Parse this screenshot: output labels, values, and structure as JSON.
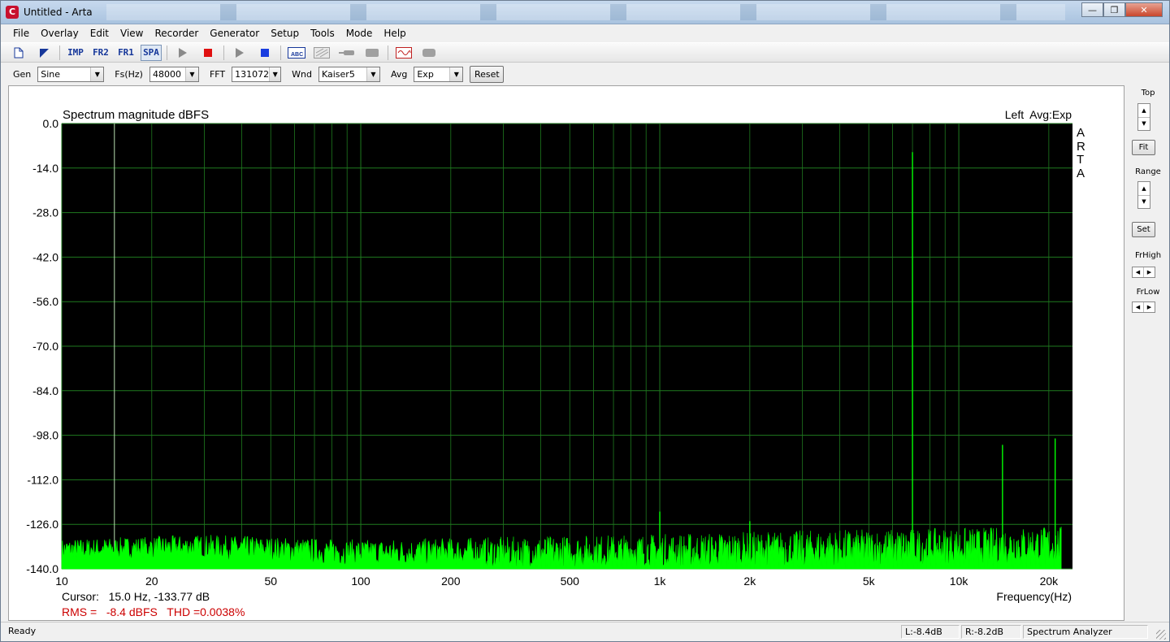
{
  "window": {
    "title": "Untitled - Arta",
    "app_icon_letter": "C"
  },
  "menu": [
    "File",
    "Overlay",
    "Edit",
    "View",
    "Recorder",
    "Generator",
    "Setup",
    "Tools",
    "Mode",
    "Help"
  ],
  "toolbar": {
    "buttons": [
      {
        "name": "new-document",
        "icon": "doc-icon",
        "text": ""
      },
      {
        "name": "open-file",
        "icon": "open-arrow-icon",
        "text": ""
      },
      {
        "name": "impulse-mode",
        "icon": "",
        "text": "IMP"
      },
      {
        "name": "fr2-mode",
        "icon": "",
        "text": "FR2"
      },
      {
        "name": "fr1-mode",
        "icon": "",
        "text": "FR1"
      },
      {
        "name": "spa-mode",
        "icon": "",
        "text": "SPA"
      },
      {
        "name": "play-record",
        "icon": "play-icon",
        "text": ""
      },
      {
        "name": "stop-record",
        "icon": "stop-icon",
        "text": ""
      },
      {
        "name": "play-generator",
        "icon": "play-icon",
        "text": ""
      },
      {
        "name": "stop-generator",
        "icon": "stop-icon",
        "text": ""
      },
      {
        "name": "overlay-set",
        "icon": "overlay-icon",
        "text": "ABC"
      },
      {
        "name": "overlay-clear",
        "icon": "overlay-off-icon",
        "text": ""
      },
      {
        "name": "smoothing",
        "icon": "probe-icon",
        "text": ""
      },
      {
        "name": "averaging",
        "icon": "gray-box-icon",
        "text": ""
      },
      {
        "name": "generator-wave",
        "icon": "wave-icon",
        "text": ""
      },
      {
        "name": "options",
        "icon": "gray-box-icon",
        "text": ""
      }
    ],
    "accent": "#16379a"
  },
  "controls": {
    "gen": {
      "label": "Gen",
      "value": "Sine"
    },
    "fs": {
      "label": "Fs(Hz)",
      "value": "48000"
    },
    "fft": {
      "label": "FFT",
      "value": "131072"
    },
    "wnd": {
      "label": "Wnd",
      "value": "Kaiser5"
    },
    "avg": {
      "label": "Avg",
      "value": "Exp"
    },
    "reset_label": "Reset"
  },
  "right_panel": {
    "top_label": "Top",
    "fit_label": "Fit",
    "range_label": "Range",
    "set_label": "Set",
    "frhigh_label": "FrHigh",
    "frlow_label": "FrLow"
  },
  "plot": {
    "title": "Spectrum magnitude dBFS",
    "channel_info": "Left  Avg:Exp",
    "watermark": [
      "A",
      "R",
      "T",
      "A"
    ],
    "x_axis_label": "Frequency(Hz)",
    "cursor_text": "Cursor:   15.0 Hz, -133.77 dB",
    "rms_text": "RMS =   -8.4 dBFS   THD =0.0038%",
    "colors": {
      "background": "#000000",
      "grid": "#1f7a1f",
      "trace": "#00ff00",
      "rms": "#cc0000"
    }
  },
  "chart_data": {
    "type": "line",
    "title": "Spectrum magnitude dBFS",
    "xlabel": "Frequency(Hz)",
    "ylabel": "",
    "x_scale": "log",
    "xlim": [
      10,
      24000
    ],
    "ylim": [
      -140,
      0
    ],
    "y_ticks": [
      "0.0",
      "-14.0",
      "-28.0",
      "-42.0",
      "-56.0",
      "-70.0",
      "-84.0",
      "-98.0",
      "-112.0",
      "-126.0",
      "-140.0"
    ],
    "x_ticks": [
      "10",
      "20",
      "50",
      "100",
      "200",
      "500",
      "1k",
      "2k",
      "5k",
      "10k",
      "20k"
    ],
    "cursor_hz": 15.0,
    "noise_floor_db": [
      {
        "x": 10,
        "y": -134
      },
      {
        "x": 30,
        "y": -133
      },
      {
        "x": 100,
        "y": -135
      },
      {
        "x": 1000,
        "y": -134
      },
      {
        "x": 5000,
        "y": -133
      },
      {
        "x": 24000,
        "y": -132
      }
    ],
    "peaks": [
      {
        "x": 1000,
        "y": -122
      },
      {
        "x": 2000,
        "y": -125
      },
      {
        "x": 7000,
        "y": -9
      },
      {
        "x": 14000,
        "y": -101
      },
      {
        "x": 21000,
        "y": -99
      }
    ],
    "grid": true
  },
  "status": {
    "ready": "Ready",
    "left_level": "L:-8.4dB",
    "right_level": "R:-8.2dB",
    "mode": "Spectrum Analyzer"
  }
}
